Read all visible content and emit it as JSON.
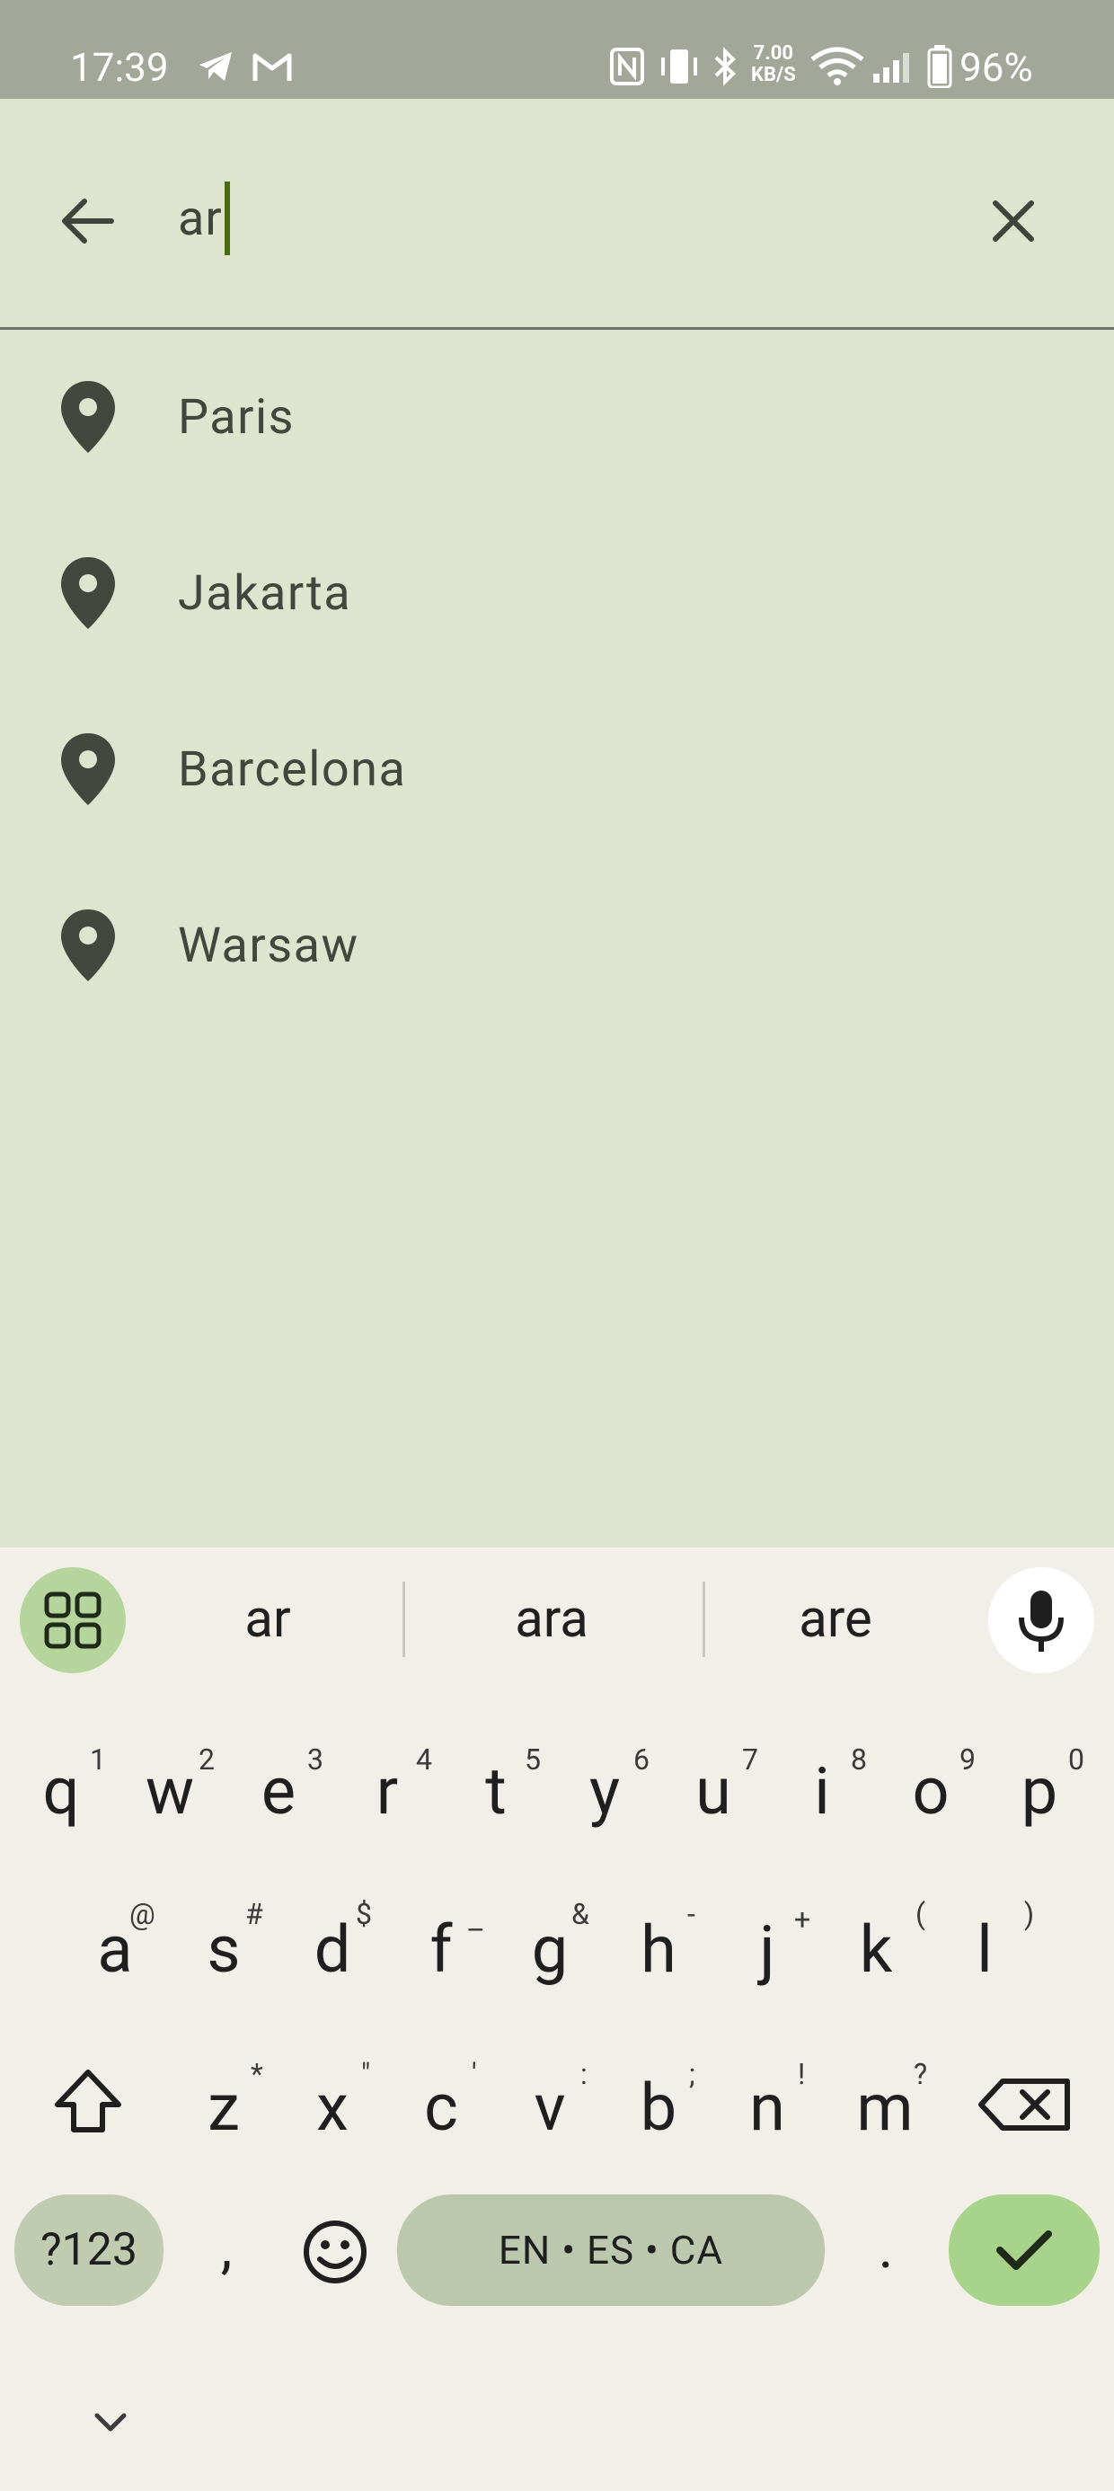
{
  "status_bar": {
    "time": "17:39",
    "speed_value": "7.00",
    "speed_unit": "KB/S",
    "battery": "96%",
    "icons": [
      "telegram-icon",
      "gmail-icon",
      "nfc-icon",
      "vibrate-icon",
      "bluetooth-icon",
      "wifi-icon",
      "signal-icon",
      "battery-icon"
    ]
  },
  "search": {
    "query": "ar",
    "back_icon": "arrow-back-icon",
    "clear_icon": "close-icon",
    "cursor_color": "#486b14"
  },
  "results": [
    {
      "label": "Paris",
      "icon": "location-pin-icon"
    },
    {
      "label": "Jakarta",
      "icon": "location-pin-icon"
    },
    {
      "label": "Barcelona",
      "icon": "location-pin-icon"
    },
    {
      "label": "Warsaw",
      "icon": "location-pin-icon"
    }
  ],
  "keyboard": {
    "suggestions": [
      "ar",
      "ara",
      "are"
    ],
    "row1": [
      {
        "key": "q",
        "hint": "1"
      },
      {
        "key": "w",
        "hint": "2"
      },
      {
        "key": "e",
        "hint": "3"
      },
      {
        "key": "r",
        "hint": "4"
      },
      {
        "key": "t",
        "hint": "5"
      },
      {
        "key": "y",
        "hint": "6"
      },
      {
        "key": "u",
        "hint": "7"
      },
      {
        "key": "i",
        "hint": "8"
      },
      {
        "key": "o",
        "hint": "9"
      },
      {
        "key": "p",
        "hint": "0"
      }
    ],
    "row2": [
      {
        "key": "a",
        "hint": "@"
      },
      {
        "key": "s",
        "hint": "#"
      },
      {
        "key": "d",
        "hint": "$"
      },
      {
        "key": "f",
        "hint": "–"
      },
      {
        "key": "g",
        "hint": "&"
      },
      {
        "key": "h",
        "hint": "-"
      },
      {
        "key": "j",
        "hint": "+"
      },
      {
        "key": "k",
        "hint": "("
      },
      {
        "key": "l",
        "hint": ")"
      }
    ],
    "row3": [
      {
        "key": "z",
        "hint": "*"
      },
      {
        "key": "x",
        "hint": "\""
      },
      {
        "key": "c",
        "hint": "'"
      },
      {
        "key": "v",
        "hint": ":"
      },
      {
        "key": "b",
        "hint": ";"
      },
      {
        "key": "n",
        "hint": "!"
      },
      {
        "key": "m",
        "hint": "?"
      }
    ],
    "symbols_label": "?123",
    "comma": ",",
    "space_label": "EN • ES • CA",
    "period": ".",
    "colors": {
      "accent": "#a7d38a",
      "tools": "#b5d59c",
      "space": "#bcc8ad"
    }
  }
}
